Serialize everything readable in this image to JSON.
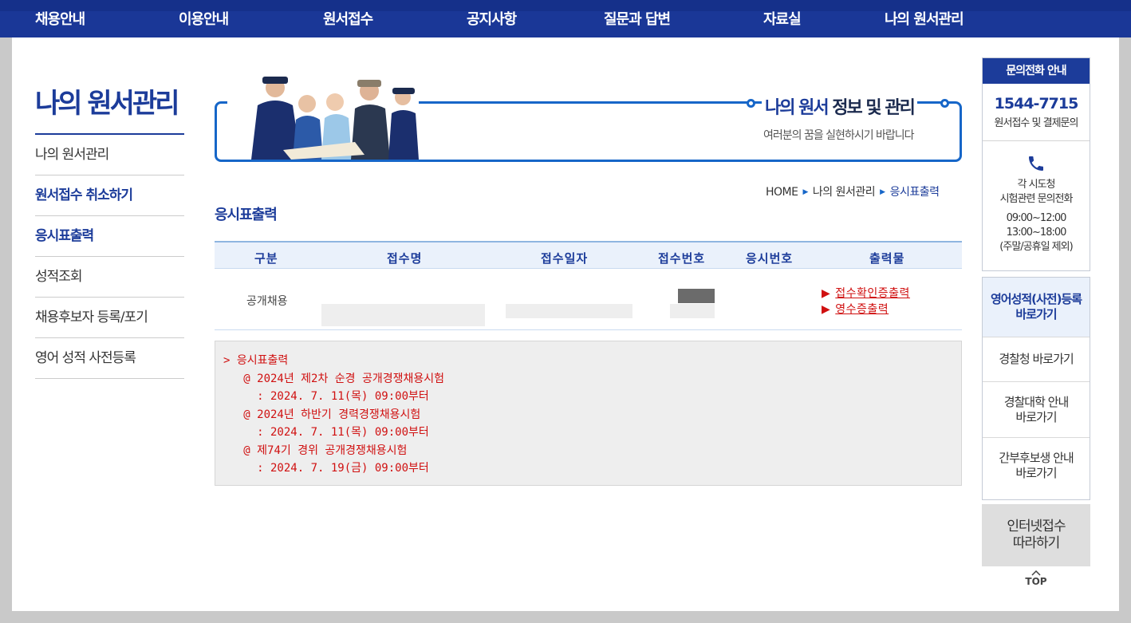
{
  "nav": {
    "items": [
      "채용안내",
      "이용안내",
      "원서접수",
      "공지사항",
      "질문과 답변",
      "자료실",
      "나의 원서관리"
    ]
  },
  "sidebar": {
    "title": "나의 원서관리",
    "items": [
      {
        "label": "나의 원서관리",
        "active": false
      },
      {
        "label": "원서접수 취소하기",
        "active": true
      },
      {
        "label": "응시표출력",
        "active": true
      },
      {
        "label": "성적조회",
        "active": false
      },
      {
        "label": "채용후보자 등록/포기",
        "active": false
      },
      {
        "label": "영어 성적 사전등록",
        "active": false
      }
    ]
  },
  "banner": {
    "title_accent": "나의 원서",
    "title_rest": " 정보 및 관리",
    "subtitle": "여러분의 꿈을 실현하시기 바랍니다"
  },
  "breadcrumb": [
    "HOME",
    "나의 원서관리",
    "응시표출력"
  ],
  "page_title": "응시표출력",
  "table": {
    "headers": [
      "구분",
      "접수명",
      "접수일자",
      "접수번호",
      "응시번호",
      "출력물"
    ],
    "row": {
      "category": "공개채용",
      "links": [
        "접수확인증출력",
        "영수증출력"
      ]
    }
  },
  "notice": {
    "lines": [
      "> 응시표출력",
      "   @ 2024년 제2차 순경 공개경쟁채용시험",
      "     : 2024. 7. 11(목) 09:00부터",
      "   @ 2024년 하반기 경력경쟁채용시험",
      "     : 2024. 7. 11(목) 09:00부터",
      "   @ 제74기 경위 공개경쟁채용시험",
      "     : 2024. 7. 19(금) 09:00부터"
    ]
  },
  "contact": {
    "header": "문의전화 안내",
    "phone": "1544-7715",
    "phone_desc": "원서접수 및 결제문의",
    "regional_line1": "각 시도청",
    "regional_line2": "시험관련 문의전화",
    "hours1": "09:00~12:00",
    "hours2": "13:00~18:00",
    "hours_note": "(주말/공휴일 제외)"
  },
  "quick_links": [
    {
      "line1": "영어성적(사전)등록",
      "line2": "바로가기"
    },
    {
      "line1": "경찰청 바로가기",
      "line2": ""
    },
    {
      "line1": "경찰대학 안내",
      "line2": "바로가기"
    },
    {
      "line1": "간부후보생 안내",
      "line2": "바로가기"
    }
  ],
  "follow_button": {
    "line1": "인터넷접수",
    "line2": "따라하기"
  },
  "top_button": "TOP",
  "colors": {
    "nav_bg": "#1a3797",
    "brand_blue": "#1c3c9a",
    "accent_red": "#d01010",
    "banner_border": "#1666c8"
  }
}
